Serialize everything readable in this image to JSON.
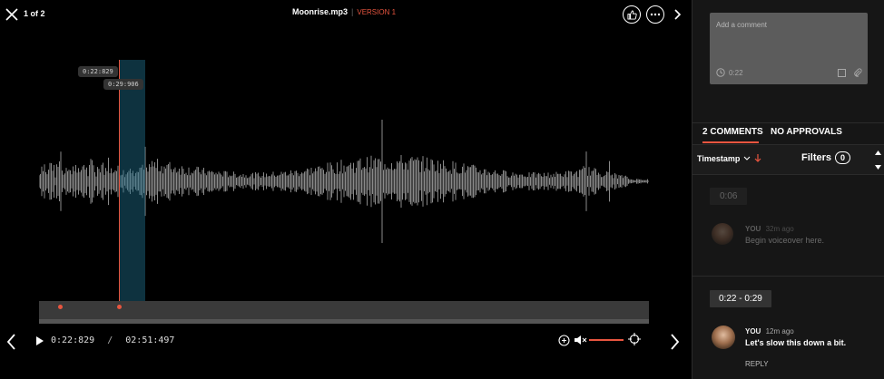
{
  "header": {
    "counter": "1 of 2",
    "file_name": "Moonrise.mp3",
    "version_label": "VERSION 1"
  },
  "player": {
    "current_time": "0:22:829",
    "separator": "/",
    "total_time": "02:51:497",
    "marker_start_label": "0:22:829",
    "marker_end_label": "0:29:906"
  },
  "comment_box": {
    "placeholder": "Add a comment",
    "timestamp": "0:22"
  },
  "tabs": {
    "comments": "2 COMMENTS",
    "approvals": "NO APPROVALS"
  },
  "filters": {
    "sort_label": "Timestamp",
    "filters_label": "Filters",
    "filters_count": "0"
  },
  "comments": [
    {
      "time_tag": "0:06",
      "author": "YOU",
      "ago": "32m ago",
      "text": "Begin voiceover here."
    },
    {
      "time_tag": "0:22 - 0:29",
      "author": "YOU",
      "ago": "12m ago",
      "text": "Let's slow this down a bit.",
      "reply": "REPLY"
    }
  ],
  "colors": {
    "accent": "#e8553f",
    "selection": "#1f6f8b",
    "panel": "#161616"
  }
}
